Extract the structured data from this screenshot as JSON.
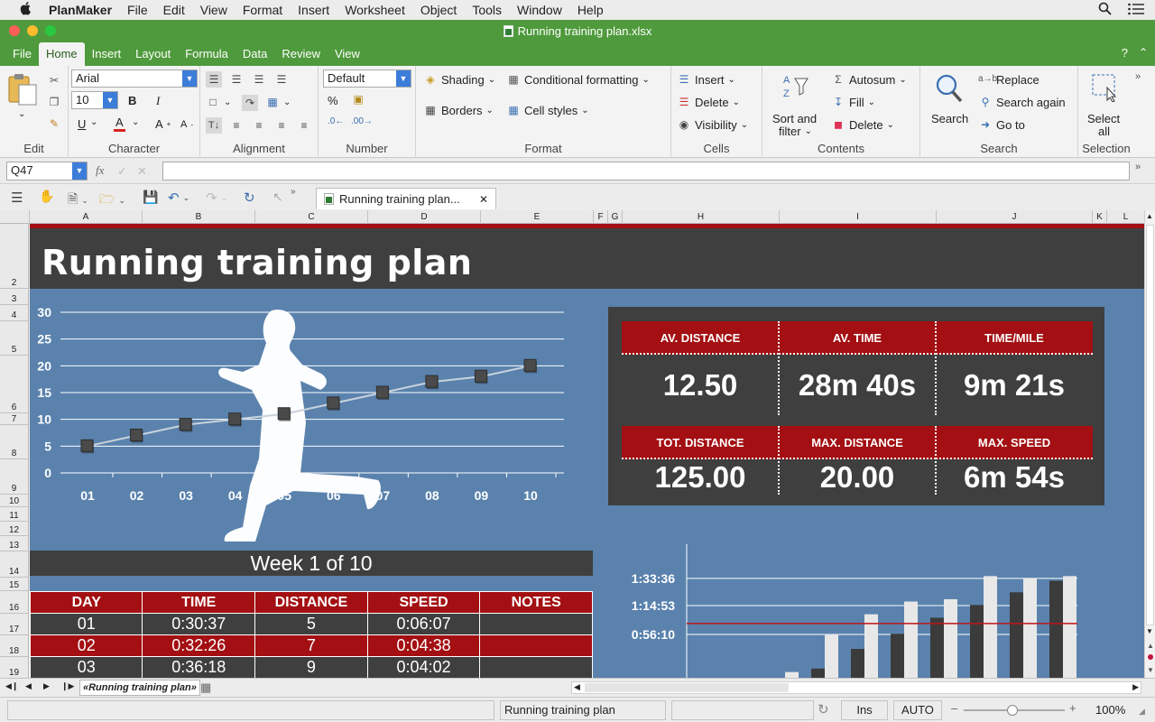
{
  "menubar": {
    "app": "PlanMaker",
    "items": [
      "File",
      "Edit",
      "View",
      "Format",
      "Insert",
      "Worksheet",
      "Object",
      "Tools",
      "Window",
      "Help"
    ]
  },
  "window": {
    "title": "Running training plan.xlsx"
  },
  "ribbon": {
    "tabs": [
      "File",
      "Home",
      "Insert",
      "Layout",
      "Formula",
      "Data",
      "Review",
      "View"
    ],
    "active_tab": "Home",
    "help": "?",
    "groups": {
      "edit": "Edit",
      "character": "Character",
      "alignment": "Alignment",
      "number": "Number",
      "format": "Format",
      "cells": "Cells",
      "contents": "Contents",
      "search": "Search",
      "selection": "Selection"
    },
    "font_name": "Arial",
    "font_size": "10",
    "number_format": "Default",
    "buttons": {
      "bold": "B",
      "italic": "I",
      "underline": "U",
      "font_color": "A",
      "grow": "A",
      "shrink": "A",
      "percent": "%",
      "shading": "Shading",
      "borders": "Borders",
      "conditional_formatting": "Conditional formatting",
      "cell_styles": "Cell styles",
      "insert": "Insert",
      "delete": "Delete",
      "visibility": "Visibility",
      "sort_filter_1": "Sort and",
      "sort_filter_2": "filter",
      "autosum": "Autosum",
      "fill": "Fill",
      "delete_contents": "Delete",
      "search": "Search",
      "replace": "Replace",
      "search_again": "Search again",
      "go_to": "Go to",
      "select_all_1": "Select",
      "select_all_2": "all"
    }
  },
  "formula_bar": {
    "cell_ref": "Q47",
    "fx": "fx",
    "formula": ""
  },
  "doc_tab": {
    "label": "Running training plan..."
  },
  "columns": [
    "A",
    "B",
    "C",
    "D",
    "E",
    "F",
    "G",
    "H",
    "I",
    "J",
    "K",
    "L"
  ],
  "rows": [
    "2",
    "3",
    "4",
    "5",
    "6",
    "7",
    "8",
    "9",
    "10",
    "11",
    "12",
    "13",
    "14",
    "15",
    "16",
    "17",
    "18",
    "19"
  ],
  "sheet": {
    "title": "Running training plan",
    "week_label": "Week 1 of 10",
    "stats": [
      {
        "label": "AV. DISTANCE",
        "value": "12.50"
      },
      {
        "label": "AV. TIME",
        "value": "28m 40s"
      },
      {
        "label": "TIME/MILE",
        "value": "9m 21s"
      },
      {
        "label": "TOT. DISTANCE",
        "value": "125.00"
      },
      {
        "label": "MAX. DISTANCE",
        "value": "20.00"
      },
      {
        "label": "MAX. SPEED",
        "value": "6m 54s"
      }
    ],
    "table": {
      "headers": [
        "DAY",
        "TIME",
        "DISTANCE",
        "SPEED",
        "NOTES"
      ],
      "rows": [
        [
          "01",
          "0:30:37",
          "5",
          "0:06:07",
          ""
        ],
        [
          "02",
          "0:32:26",
          "7",
          "0:04:38",
          ""
        ],
        [
          "03",
          "0:36:18",
          "9",
          "0:04:02",
          ""
        ]
      ]
    }
  },
  "chart_data": [
    {
      "type": "line",
      "title": "",
      "categories": [
        "01",
        "02",
        "03",
        "04",
        "05",
        "06",
        "07",
        "08",
        "09",
        "10"
      ],
      "values": [
        5,
        7,
        9,
        10,
        11,
        13,
        15,
        17,
        18,
        20
      ],
      "ylim": [
        0,
        30
      ],
      "yticks": [
        "0",
        "5",
        "10",
        "15",
        "20",
        "25",
        "30"
      ],
      "grid": true,
      "colors": {
        "line": "#c8d2dc",
        "marker": "#4a4a4a",
        "grid": "#ffffff",
        "text": "#ffffff"
      }
    },
    {
      "type": "bar",
      "title": "",
      "yticks": [
        "0:56:10",
        "1:14:53",
        "1:33:36"
      ],
      "series": [
        {
          "values": [
            0.0,
            0.08,
            0.25,
            0.38,
            0.52,
            0.63,
            0.74,
            0.84
          ]
        },
        {
          "values": [
            0.05,
            0.37,
            0.55,
            0.66,
            0.68,
            0.88,
            0.86,
            0.88
          ]
        }
      ],
      "reference_line": 0.47,
      "grid": true,
      "colors": {
        "series_a": "#3b3b3b",
        "series_b": "#e8e8e8",
        "reference": "#c0141a",
        "grid": "#ffffff"
      }
    }
  ],
  "tabbar": {
    "sheet_name": "«Running training plan»"
  },
  "statusbar": {
    "sheet": "Running training plan",
    "mode_ins": "Ins",
    "mode_auto": "AUTO",
    "zoom": "100%"
  }
}
